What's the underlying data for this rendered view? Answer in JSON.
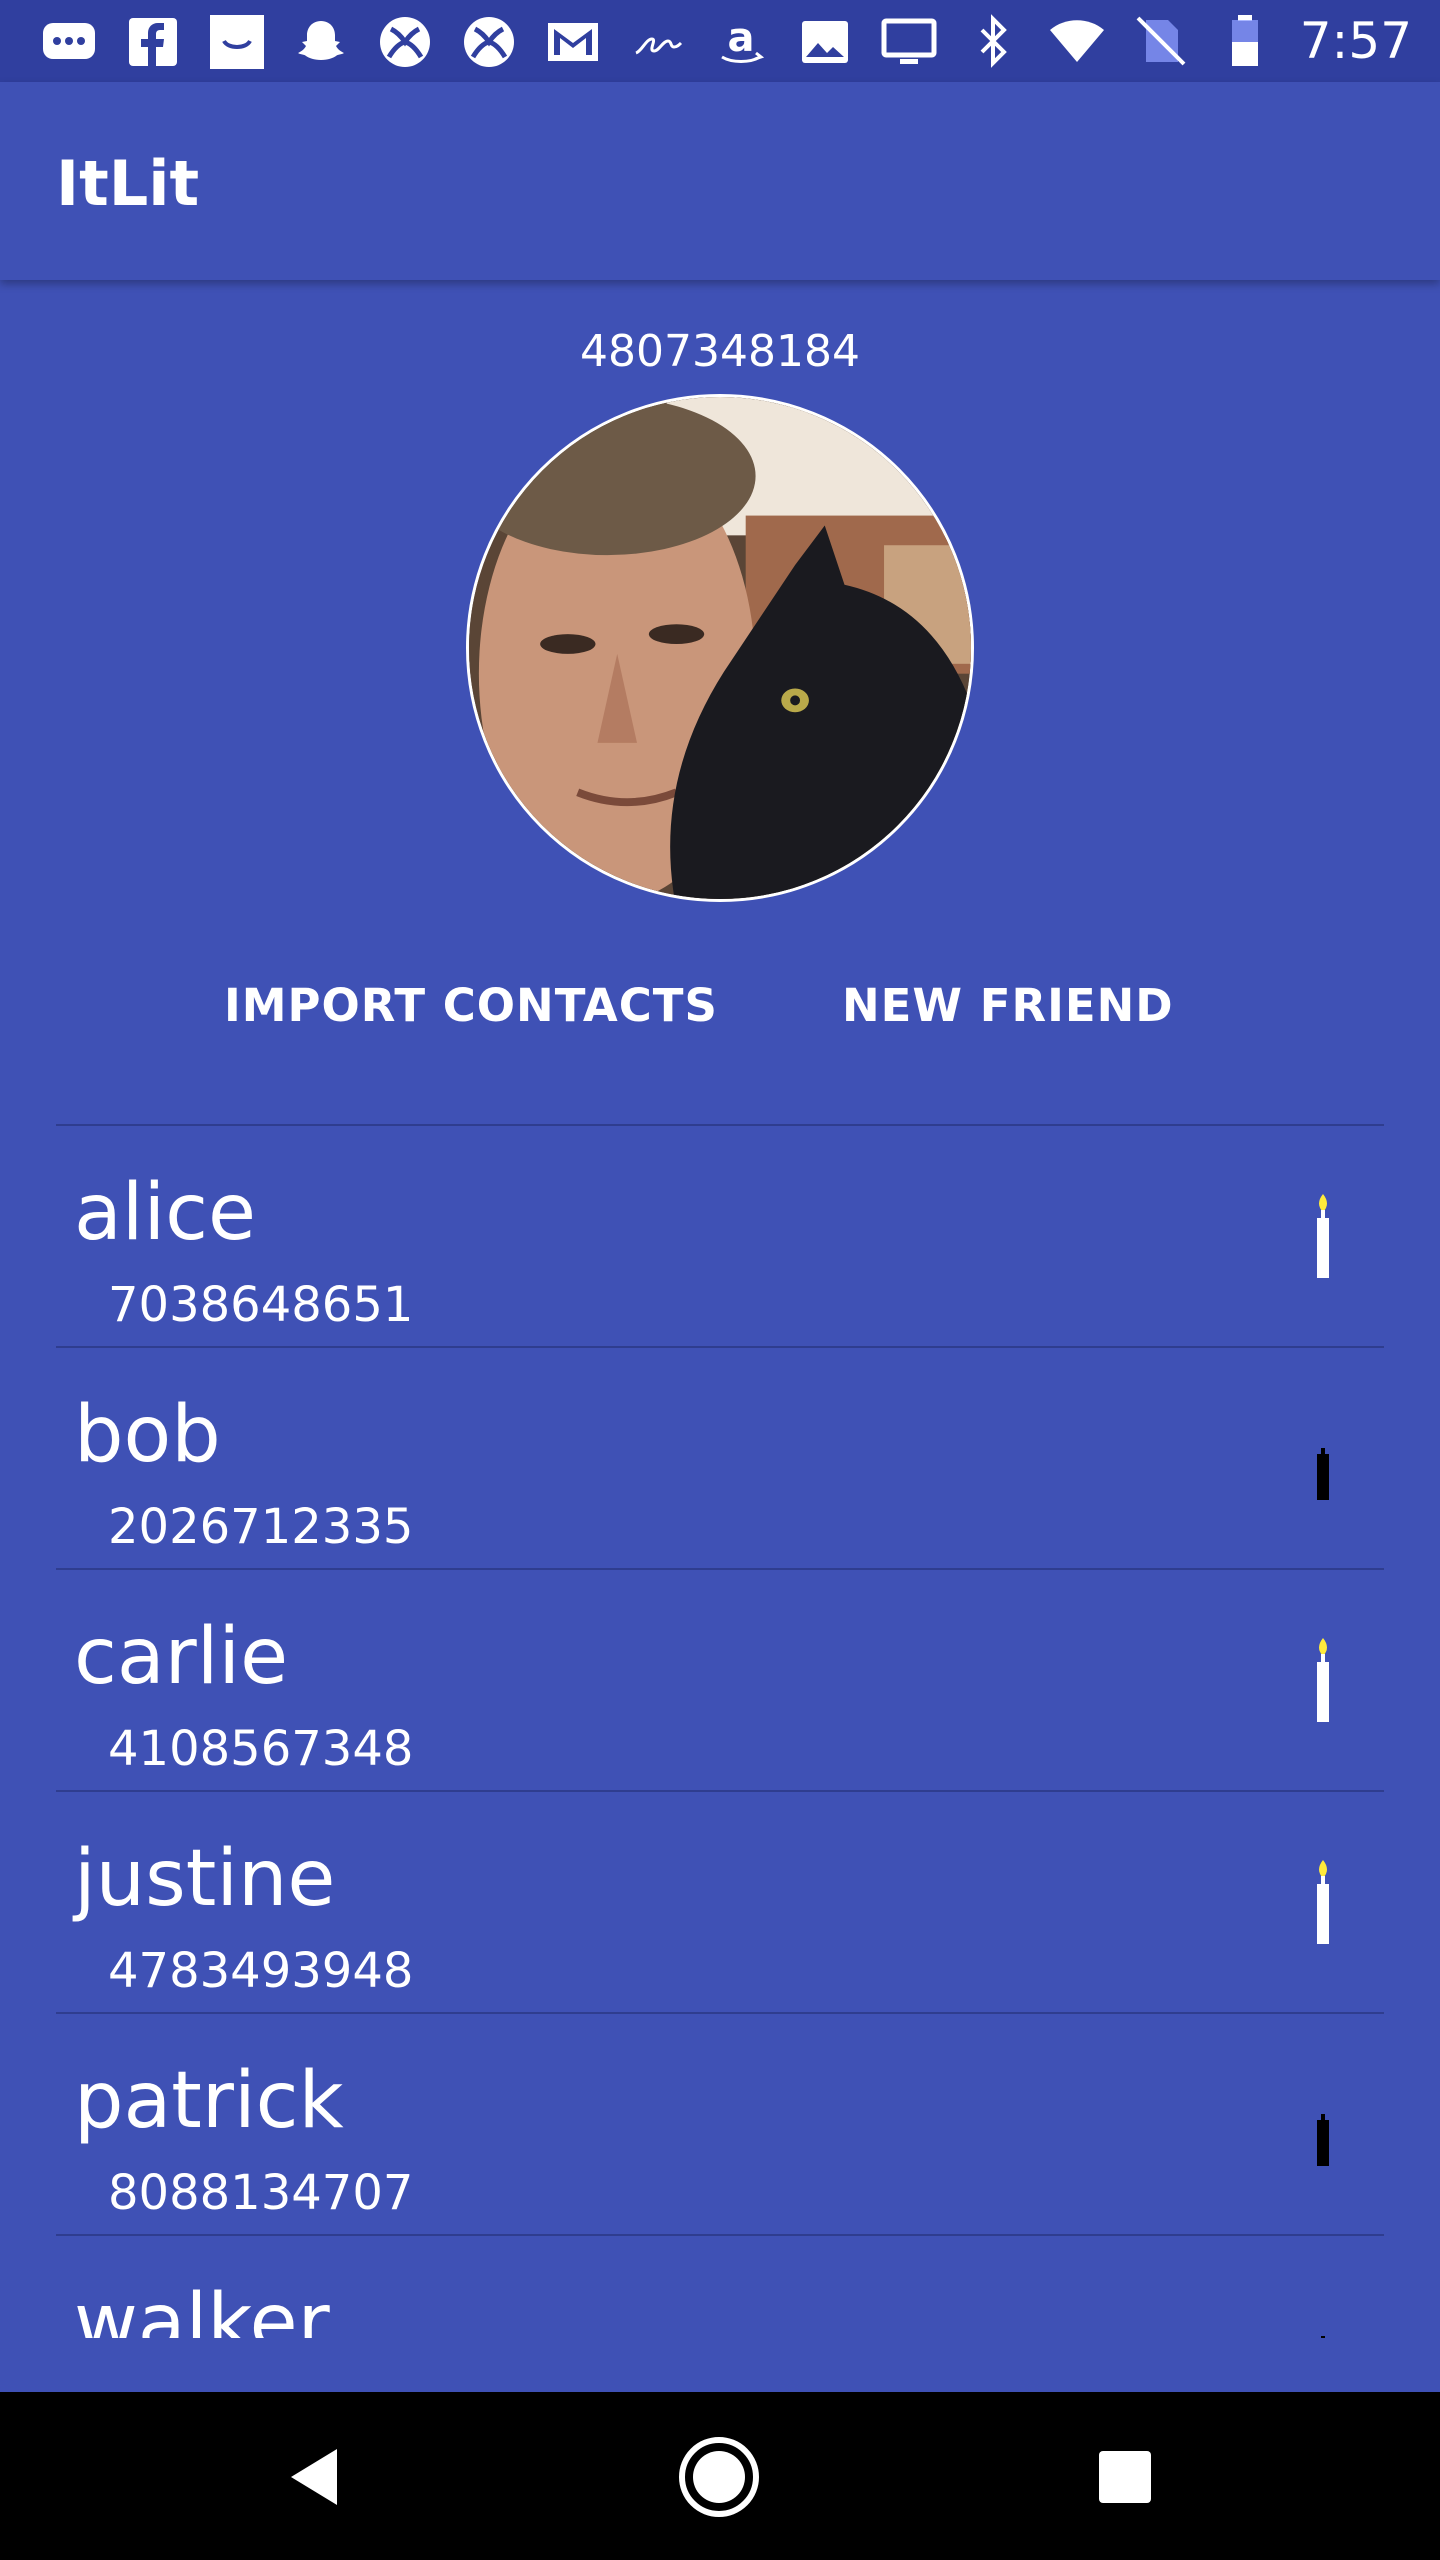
{
  "status_bar": {
    "time": "7:57",
    "left_icons": [
      "messages-icon",
      "facebook-icon",
      "shopping-bag-icon",
      "snapchat-icon",
      "xbox-icon",
      "xbox-icon",
      "gmail-icon",
      "signature-icon",
      "amazon-icon",
      "photos-icon",
      "cast-screen-icon"
    ],
    "right_icons": [
      "bluetooth-icon",
      "wifi-icon",
      "no-sim-icon",
      "battery-icon"
    ]
  },
  "app_bar": {
    "title": "ItLit"
  },
  "profile": {
    "phone": "4807348184"
  },
  "actions": {
    "import_label": "IMPORT CONTACTS",
    "new_friend_label": "NEW FRIEND"
  },
  "friends": [
    {
      "name": "alice",
      "phone": "7038648651",
      "lit": true
    },
    {
      "name": "bob",
      "phone": "2026712335",
      "lit": false
    },
    {
      "name": "carlie",
      "phone": "4108567348",
      "lit": true
    },
    {
      "name": "justine",
      "phone": "4783493948",
      "lit": true
    },
    {
      "name": "patrick",
      "phone": "8088134707",
      "lit": false
    },
    {
      "name": "walker",
      "phone": "",
      "lit": false
    }
  ],
  "colors": {
    "primary": "#3f51b5",
    "primary_dark": "#303f9f",
    "flame": "#ffeb3b",
    "candle_lit": "#ffffff",
    "candle_unlit": "#000000"
  },
  "nav_bar": {
    "icons": [
      "back-icon",
      "home-icon",
      "recents-icon"
    ]
  }
}
